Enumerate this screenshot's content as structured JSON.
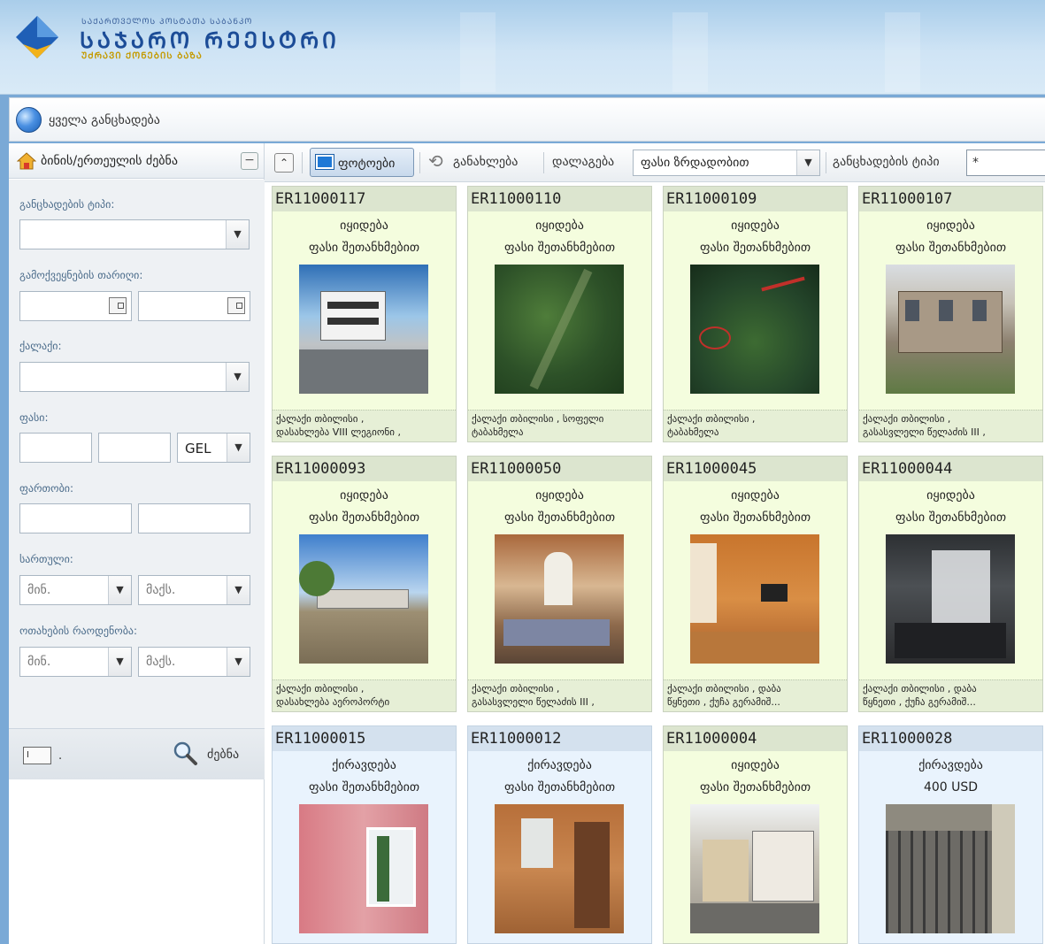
{
  "header": {
    "logo_small": "ᲡᲐᲥᲐᲠᲗᲕᲔᲚᲝᲡ ᲞᲝᲡᲢᲐᲗᲐ ᲡᲐᲑᲐᲜᲙᲝ",
    "logo_big": "ᲡᲐᲯᲐᲠᲝ ᲠᲔᲔᲡᲢᲠᲘ",
    "logo_sub": "ᲣᲫᲠᲐᲕᲘ ᲥᲝᲜᲔᲑᲘᲡ ᲑᲐᲖᲐ"
  },
  "topbar": {
    "title": "ყველა განცხადება"
  },
  "sidebar": {
    "title": "ბინის/ერთეულის ძებნა",
    "collapse": "−",
    "fields": {
      "type_label": "განცხადების ტიპი:",
      "date_label": "გამოქვეყნების თარიღი:",
      "city_label": "ქალაქი:",
      "price_label": "ფასი:",
      "currency": "GEL",
      "area_label": "ფართობი:",
      "floor_label": "სართული:",
      "rooms_label": "ოთახების რაოდენობა:",
      "min": "მინ.",
      "max": "მაქს."
    },
    "bottom": {
      "dot": ".",
      "search": "ძებნა",
      "mini_icon": "I"
    }
  },
  "toolbar": {
    "up": "⌃",
    "photos": "ფოტოები",
    "refresh": "განახლება",
    "sort_label": "დალაგება",
    "sort_value": "ფასი ზრდადობით",
    "type_label": "განცხადების ტიპი",
    "type_value": "*"
  },
  "listings": [
    {
      "code": "ER11000117",
      "type": "იყიდება",
      "price": "ფასი შეთანხმებით",
      "addr1": "ქალაქი თბილისი ,",
      "addr2": "დასახლება VIII ლეგიონი ,",
      "kind": "sale"
    },
    {
      "code": "ER11000110",
      "type": "იყიდება",
      "price": "ფასი შეთანხმებით",
      "addr1": "ქალაქი თბილისი , სოფელი",
      "addr2": "ტაბახმელა",
      "kind": "sale"
    },
    {
      "code": "ER11000109",
      "type": "იყიდება",
      "price": "ფასი შეთანხმებით",
      "addr1": "ქალაქი თბილისი ,",
      "addr2": "ტაბახმელა",
      "kind": "sale"
    },
    {
      "code": "ER11000107",
      "type": "იყიდება",
      "price": "ფასი შეთანხმებით",
      "addr1": "ქალაქი თბილისი ,",
      "addr2": "გასასვლელი წელაძის III ,",
      "kind": "sale"
    },
    {
      "code": "ER11000093",
      "type": "იყიდება",
      "price": "ფასი შეთანხმებით",
      "addr1": "ქალაქი თბილისი ,",
      "addr2": "დასახლება აეროპორტი",
      "kind": "sale"
    },
    {
      "code": "ER11000050",
      "type": "იყიდება",
      "price": "ფასი შეთანხმებით",
      "addr1": "ქალაქი თბილისი ,",
      "addr2": "გასასვლელი წელაძის III ,",
      "kind": "sale"
    },
    {
      "code": "ER11000045",
      "type": "იყიდება",
      "price": "ფასი შეთანხმებით",
      "addr1": "ქალაქი თბილისი , დაბა",
      "addr2": "წყნეთი , ქუჩა გერამიშ...",
      "kind": "sale"
    },
    {
      "code": "ER11000044",
      "type": "იყიდება",
      "price": "ფასი შეთანხმებით",
      "addr1": "ქალაქი თბილისი , დაბა",
      "addr2": "წყნეთი , ქუჩა გერამიშ...",
      "kind": "sale"
    },
    {
      "code": "ER11000015",
      "type": "ქირავდება",
      "price": "ფასი შეთანხმებით",
      "addr1": "",
      "addr2": "",
      "kind": "rent"
    },
    {
      "code": "ER11000012",
      "type": "ქირავდება",
      "price": "ფასი შეთანხმებით",
      "addr1": "",
      "addr2": "",
      "kind": "rent"
    },
    {
      "code": "ER11000004",
      "type": "იყიდება",
      "price": "ფასი შეთანხმებით",
      "addr1": "",
      "addr2": "",
      "kind": "sale"
    },
    {
      "code": "ER11000028",
      "type": "ქირავდება",
      "price": "400 USD",
      "addr1": "",
      "addr2": "",
      "kind": "rent"
    }
  ]
}
